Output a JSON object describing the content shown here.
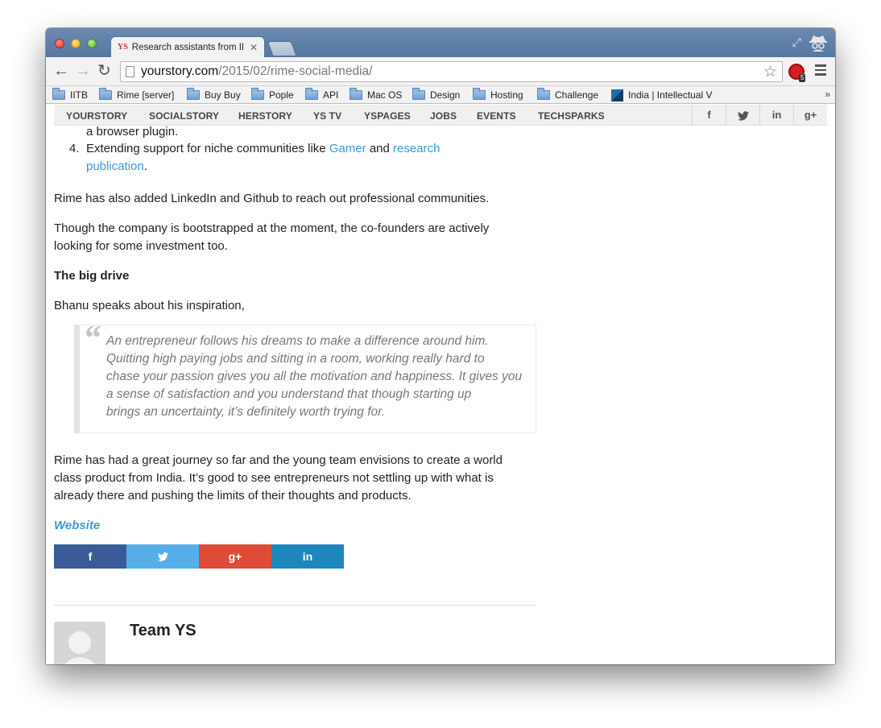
{
  "browser": {
    "tab_title": "Research assistants from II",
    "tab_favicon": "YS",
    "url_host": "yourstory.com",
    "url_path": "/2015/02/rime-social-media/",
    "extension_badge": "5",
    "bookmarks": [
      {
        "label": "IITB",
        "icon": "folder-icon"
      },
      {
        "label": "Rime [server]",
        "icon": "folder-icon"
      },
      {
        "label": "Buy Buy",
        "icon": "folder-icon"
      },
      {
        "label": "Pople",
        "icon": "folder-icon"
      },
      {
        "label": "API",
        "icon": "folder-icon"
      },
      {
        "label": "Mac OS",
        "icon": "folder-icon"
      },
      {
        "label": "Design",
        "icon": "folder-icon"
      },
      {
        "label": "Hosting",
        "icon": "folder-icon"
      },
      {
        "label": "Challenge",
        "icon": "folder-icon"
      },
      {
        "label": "India | Intellectual V",
        "icon": "site-favicon"
      }
    ],
    "bookmarks_more": "»"
  },
  "site_nav": {
    "items": [
      "YOURSTORY",
      "SOCIALSTORY",
      "HERSTORY",
      "YS TV",
      "YSPAGES",
      "JOBS",
      "EVENTS",
      "TECHSPARKS"
    ],
    "social": [
      "f",
      "twitter-icon",
      "in",
      "g+"
    ]
  },
  "article": {
    "list_tail": "a browser plugin.",
    "list_item_4": {
      "number": "4.",
      "text_before": "Extending support for niche communities like ",
      "link1": "Gamer",
      "text_mid": " and ",
      "link2_line1": "research",
      "link2_line2": "publication",
      "text_after": "."
    },
    "p1": "Rime has also added LinkedIn and Github to reach out professional communities.",
    "p2_line1": "Though the company is bootstrapped at the moment, the co-founders are actively",
    "p2_line2": "looking for some investment too.",
    "heading": "The big drive",
    "p3": "Bhanu speaks about his inspiration,",
    "quote": {
      "mark": "“",
      "lines": [
        "An entrepreneur follows his dreams to make a difference around him.",
        "Quitting high paying jobs and sitting in a room, working really hard to",
        "chase your passion gives you all the motivation and happiness. It gives you",
        "a sense of satisfaction and you understand that though starting up",
        "brings an uncertainty, it’s definitely worth trying for."
      ]
    },
    "p4_lines": [
      "Rime has had a great journey so far and the young team envisions to create a world",
      "class product from India. It’s good to see entrepreneurs not settling up with what is",
      "already there and pushing the limits of their thoughts and products."
    ],
    "website_link": "Website",
    "share": [
      {
        "label": "f",
        "color": "#3b5a98"
      },
      {
        "label": "🐦",
        "color": "#56aee9"
      },
      {
        "label": "g+",
        "color": "#de4b39"
      },
      {
        "label": "in",
        "color": "#1d87bd"
      }
    ],
    "author": "Team YS"
  }
}
